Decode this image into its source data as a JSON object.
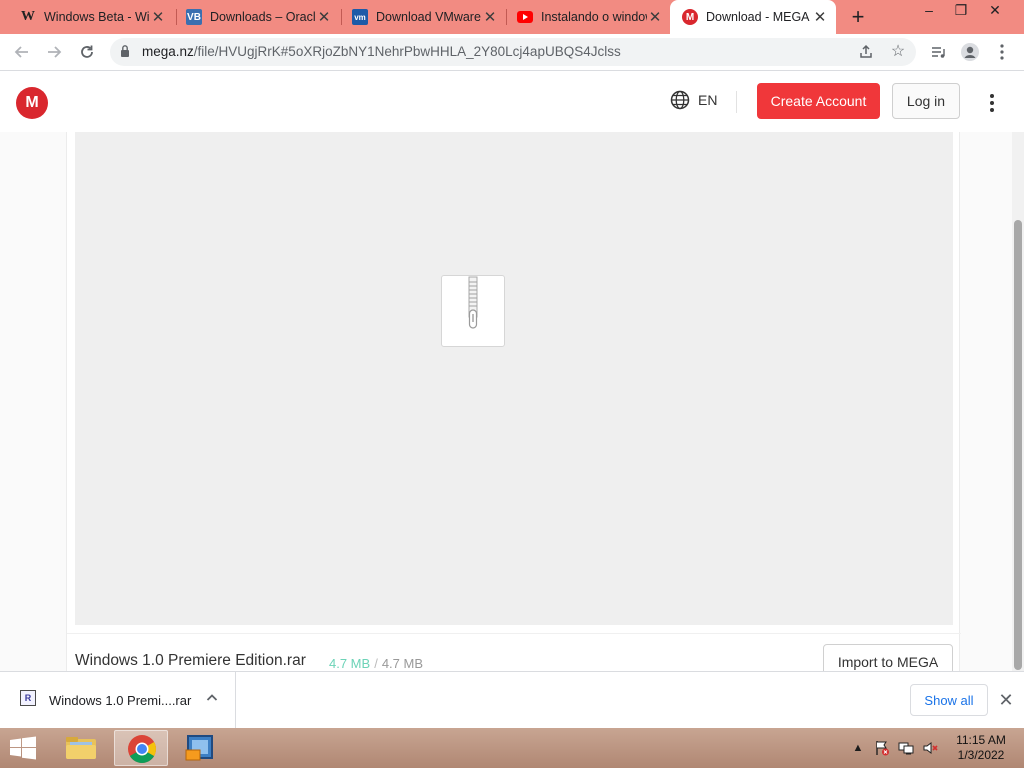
{
  "browser": {
    "tabs": [
      {
        "title": "Windows Beta - Wiki",
        "favicon": "W"
      },
      {
        "title": "Downloads – Oracle VM VirtualBox",
        "favicon": "VB"
      },
      {
        "title": "Download VMware Workstation",
        "favicon": "vm"
      },
      {
        "title": "Instalando o windows",
        "favicon": "yt"
      },
      {
        "title": "Download - MEGA",
        "favicon": "M"
      }
    ],
    "address": {
      "host": "mega.nz",
      "path": "/file/HVUgjRrK#5oXRjoZbNY1NehrPbwHHLA_2Y80Lcj4apUBQS4Jclss"
    }
  },
  "mega": {
    "logo_letter": "M",
    "lang": "EN",
    "create_account": "Create Account",
    "login": "Log in",
    "file": {
      "name": "Windows 1.0 Premiere Edition.rar",
      "downloaded": "4.7 MB",
      "separator": "/",
      "total": "4.7 MB"
    },
    "import_button": "Import to MEGA"
  },
  "downloads": {
    "item_name": "Windows 1.0 Premi....rar",
    "show_all": "Show all"
  },
  "taskbar": {
    "time": "11:15 AM",
    "date": "1/3/2022"
  },
  "colors": {
    "tabstrip": "#f28b82",
    "mega_red": "#d9272e",
    "create_button": "#f0373a",
    "progress_text": "#6cd3b7",
    "link_blue": "#1a73e8"
  }
}
